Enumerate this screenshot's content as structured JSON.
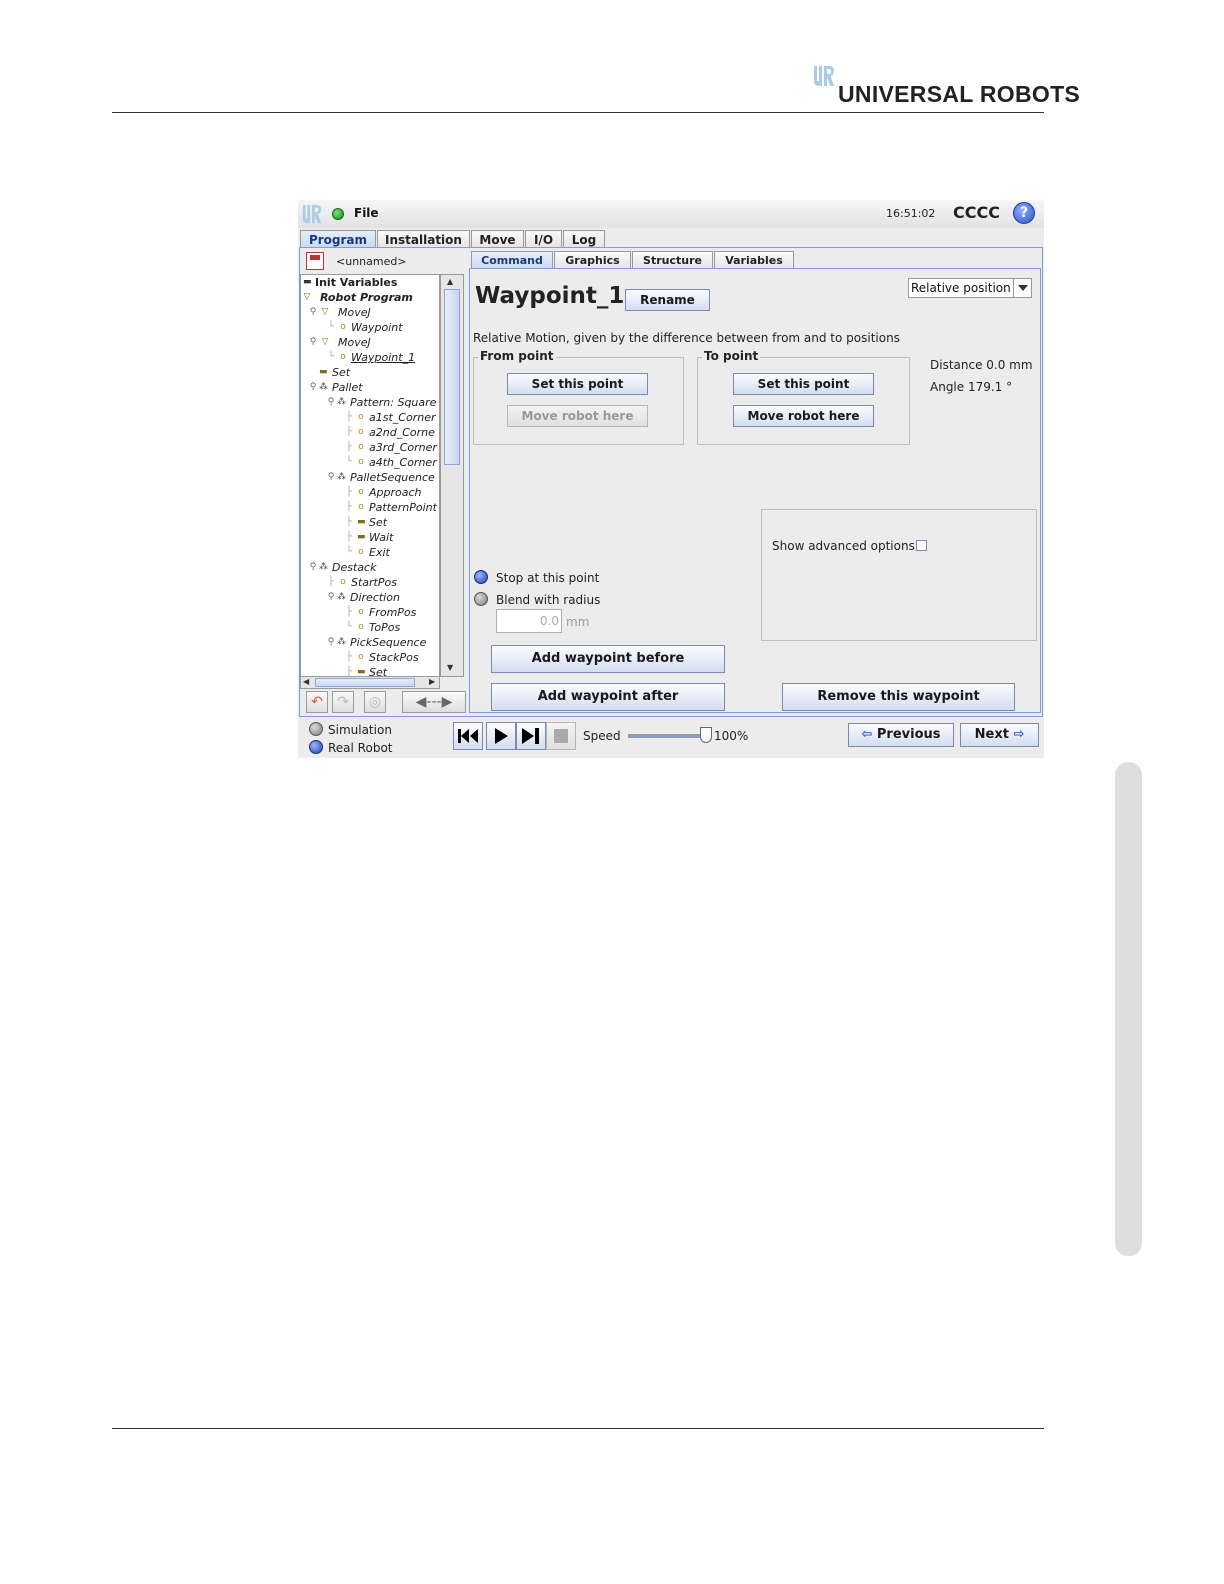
{
  "page": {
    "brand": "UNIVERSAL ROBOTS"
  },
  "window": {
    "titlebar": {
      "menu_file": "File",
      "time": "16:51:02",
      "robot_name": "CCCC",
      "help_symbol": "?"
    },
    "main_tabs": [
      {
        "label": "Program",
        "active": true
      },
      {
        "label": "Installation",
        "active": false
      },
      {
        "label": "Move",
        "active": false
      },
      {
        "label": "I/O",
        "active": false
      },
      {
        "label": "Log",
        "active": false
      }
    ],
    "program": {
      "file_name": "<unnamed>",
      "tree": [
        {
          "label": "Init Variables",
          "icon": "bar-icon",
          "style": "bold"
        },
        {
          "label": "Robot Program",
          "icon": "triangle-icon",
          "style": "bold-italic"
        },
        {
          "label": "MoveJ",
          "icon": "triangle-icon",
          "style": "italic"
        },
        {
          "label": "Waypoint",
          "icon": "waypoint-icon",
          "style": "italic"
        },
        {
          "label": "MoveJ",
          "icon": "triangle-icon",
          "style": "italic"
        },
        {
          "label": "Waypoint_1",
          "icon": "waypoint-icon",
          "style": "italic",
          "selected": true
        },
        {
          "label": "Set",
          "icon": "bar-icon",
          "style": "italic"
        },
        {
          "label": "Pallet",
          "icon": "pallet-icon",
          "style": "italic"
        },
        {
          "label": "Pattern: Square",
          "icon": "pallet-icon",
          "style": "italic"
        },
        {
          "label": "a1st_Corner",
          "icon": "waypoint-icon",
          "style": "italic"
        },
        {
          "label": "a2nd_Corne",
          "icon": "waypoint-icon",
          "style": "italic"
        },
        {
          "label": "a3rd_Corner",
          "icon": "waypoint-icon",
          "style": "italic"
        },
        {
          "label": "a4th_Corner",
          "icon": "waypoint-icon",
          "style": "italic"
        },
        {
          "label": "PalletSequence",
          "icon": "pallet-icon",
          "style": "italic"
        },
        {
          "label": "Approach",
          "icon": "waypoint-icon",
          "style": "italic"
        },
        {
          "label": "PatternPoint",
          "icon": "waypoint-icon",
          "style": "italic"
        },
        {
          "label": "Set",
          "icon": "bar-icon",
          "style": "italic"
        },
        {
          "label": "Wait",
          "icon": "bar-icon",
          "style": "italic"
        },
        {
          "label": "Exit",
          "icon": "waypoint-icon",
          "style": "italic"
        },
        {
          "label": "Destack",
          "icon": "pallet-icon",
          "style": "italic"
        },
        {
          "label": "StartPos",
          "icon": "waypoint-icon",
          "style": "italic"
        },
        {
          "label": "Direction",
          "icon": "pallet-icon",
          "style": "italic"
        },
        {
          "label": "FromPos",
          "icon": "waypoint-icon",
          "style": "italic"
        },
        {
          "label": "ToPos",
          "icon": "waypoint-icon",
          "style": "italic"
        },
        {
          "label": "PickSequence",
          "icon": "pallet-icon",
          "style": "italic"
        },
        {
          "label": "StackPos",
          "icon": "waypoint-icon",
          "style": "italic"
        },
        {
          "label": "Set",
          "icon": "bar-icon",
          "style": "italic"
        }
      ]
    },
    "sub_tabs": [
      {
        "label": "Command",
        "active": true
      },
      {
        "label": "Graphics",
        "active": false
      },
      {
        "label": "Structure",
        "active": false
      },
      {
        "label": "Variables",
        "active": false
      }
    ],
    "command": {
      "waypoint_name": "Waypoint_1",
      "rename_label": "Rename",
      "position_type": "Relative position",
      "description": "Relative Motion, given by the difference between from and to positions",
      "from_point": {
        "title": "From point",
        "set_label": "Set this point",
        "move_label": "Move robot here",
        "move_enabled": false
      },
      "to_point": {
        "title": "To point",
        "set_label": "Set this point",
        "move_label": "Move robot here",
        "move_enabled": true
      },
      "distance": "Distance 0.0 mm",
      "angle": "Angle 179.1 °",
      "stop_label": "Stop at this point",
      "blend_label": "Blend with radius",
      "blend_value": "0.0",
      "blend_unit": "mm",
      "advanced_label": "Show advanced options",
      "advanced_checked": false,
      "add_before_label": "Add waypoint before",
      "add_after_label": "Add waypoint after",
      "remove_label": "Remove this waypoint"
    },
    "bottom": {
      "simulation_label": "Simulation",
      "real_robot_label": "Real Robot",
      "speed_label": "Speed",
      "speed_value": "100%",
      "speed_fraction": 1.0,
      "previous_label": "Previous",
      "next_label": "Next"
    },
    "colors": {
      "accent": "#7f9ed6",
      "button_text": "#1a1a1a",
      "status_green": "#1a8a1a"
    }
  }
}
